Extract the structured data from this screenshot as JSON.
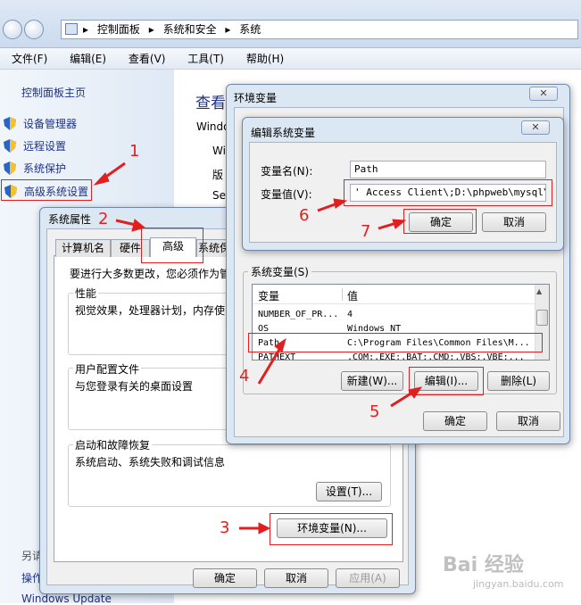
{
  "explorer": {
    "breadcrumbs": [
      "控制面板",
      "系统和安全",
      "系统"
    ],
    "menu": [
      "文件(F)",
      "编辑(E)",
      "查看(V)",
      "工具(T)",
      "帮助(H)"
    ],
    "left_panel": {
      "home": "控制面板主页",
      "items": [
        "设备管理器",
        "远程设置",
        "系统保护",
        "高级系统设置"
      ],
      "see_also": "另请",
      "ops": "操作",
      "update": "Windows Update"
    },
    "main": {
      "title": "查看",
      "windows_label": "Windo",
      "frag1": "Wi",
      "frag2": "版",
      "frag3": "Se"
    }
  },
  "sys_props": {
    "title": "系统属性",
    "tabs": [
      "计算机名",
      "硬件",
      "高级",
      "系统保"
    ],
    "intro": "要进行大多数更改，您必须作为管",
    "perf": {
      "label": "性能",
      "text": "视觉效果，处理器计划，内存使"
    },
    "profile": {
      "label": "用户配置文件",
      "text": "与您登录有关的桌面设置"
    },
    "startup": {
      "label": "启动和故障恢复",
      "text": "系统启动、系统失败和调试信息",
      "button": "设置(T)..."
    },
    "env_button": "环境变量(N)...",
    "ok": "确定",
    "cancel": "取消",
    "apply": "应用(A)"
  },
  "env_vars": {
    "title": "环境变量",
    "system_label": "系统变量(S)",
    "columns": [
      "变量",
      "值"
    ],
    "rows": [
      {
        "name": "NUMBER_OF_PR...",
        "value": "4"
      },
      {
        "name": "OS",
        "value": "Windows_NT"
      },
      {
        "name": "Path",
        "value": "C:\\Program Files\\Common Files\\M..."
      },
      {
        "name": "PATHEXT",
        "value": ".COM;.EXE;.BAT;.CMD;.VBS;.VBE;..."
      }
    ],
    "new": "新建(W)...",
    "edit": "编辑(I)...",
    "delete": "删除(L)",
    "ok": "确定",
    "cancel": "取消"
  },
  "edit_var": {
    "title": "编辑系统变量",
    "name_label": "变量名(N):",
    "name_value": "Path",
    "value_label": "变量值(V):",
    "value_value": "' Access Client\\;D:\\phpweb\\mysql\\bin",
    "ok": "确定",
    "cancel": "取消"
  },
  "steps": [
    "1",
    "2",
    "3",
    "4",
    "5",
    "6",
    "7"
  ],
  "watermark": "Bai 经验",
  "watermark_url": "jingyan.baidu.com",
  "colors": {
    "annotation": "#e02020",
    "link": "#1e3287",
    "window_frame": "#dce7f4"
  }
}
